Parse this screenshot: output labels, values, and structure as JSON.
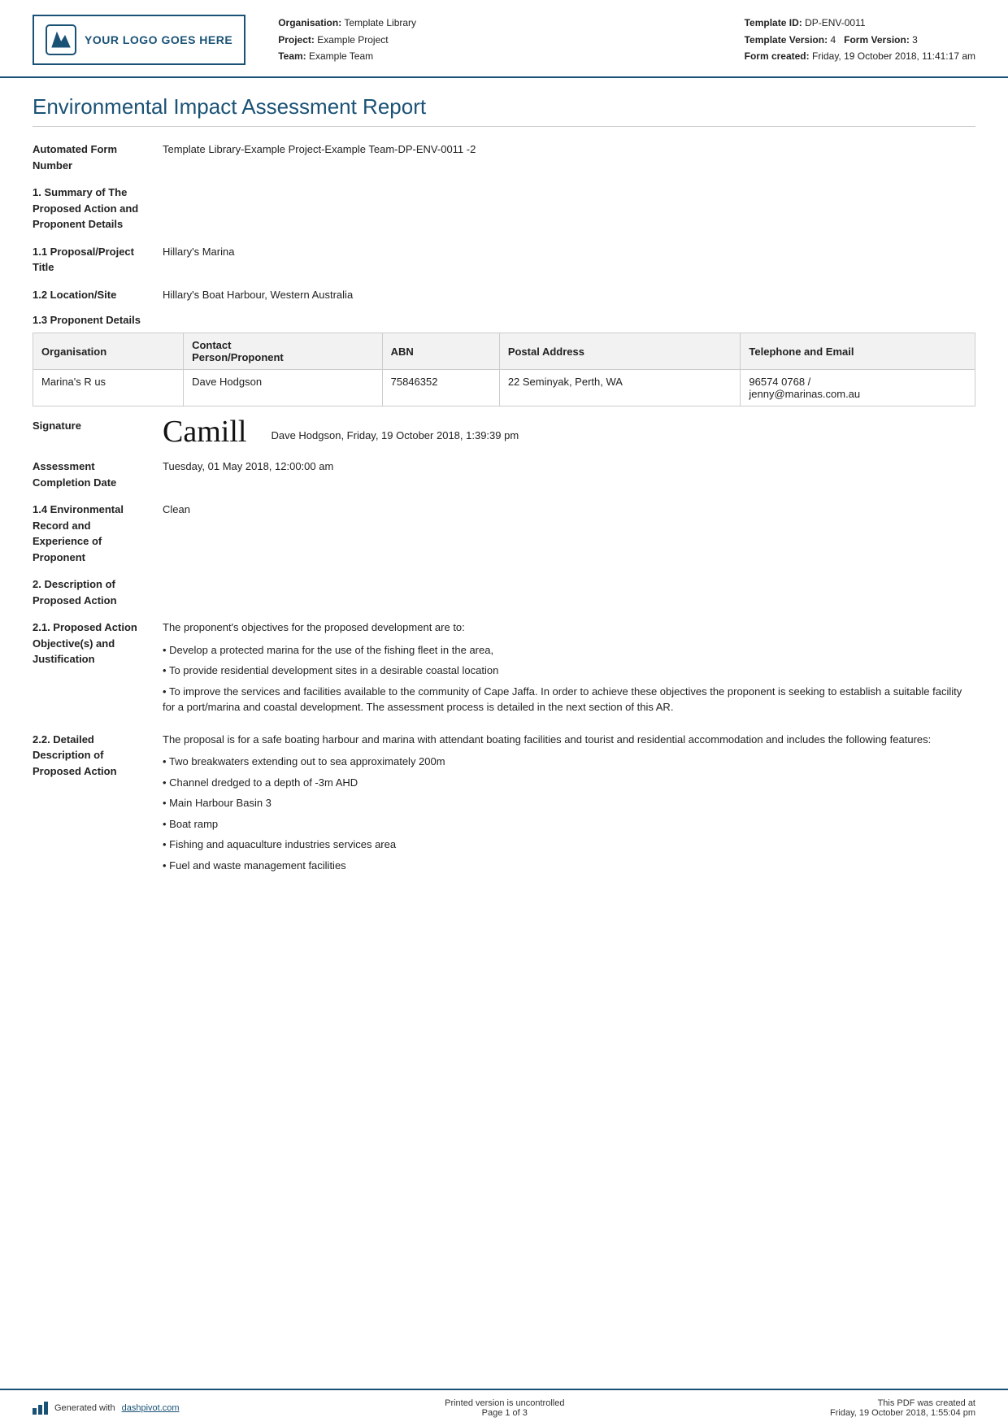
{
  "header": {
    "logo_text": "YOUR LOGO GOES HERE",
    "org_label": "Organisation:",
    "org_value": "Template Library",
    "project_label": "Project:",
    "project_value": "Example Project",
    "team_label": "Team:",
    "team_value": "Example Team",
    "template_id_label": "Template ID:",
    "template_id_value": "DP-ENV-0011",
    "template_version_label": "Template Version:",
    "template_version_value": "4",
    "form_version_label": "Form Version:",
    "form_version_value": "3",
    "form_created_label": "Form created:",
    "form_created_value": "Friday, 19 October 2018, 11:41:17 am"
  },
  "report": {
    "title": "Environmental Impact Assessment Report",
    "automated_form_number_label": "Automated Form Number",
    "automated_form_number_value": "Template Library-Example Project-Example Team-DP-ENV-0011  -2",
    "section1_label": "1. Summary of The Proposed Action and Proponent Details",
    "section1_1_label": "1.1 Proposal/Project Title",
    "section1_1_value": "Hillary's Marina",
    "section1_2_label": "1.2 Location/Site",
    "section1_2_value": "Hillary's Boat Harbour, Western Australia",
    "section1_3_label": "1.3 Proponent Details",
    "table": {
      "headers": [
        "Organisation",
        "Contact Person/Proponent",
        "ABN",
        "Postal Address",
        "Telephone and Email"
      ],
      "rows": [
        [
          "Marina's R us",
          "Dave Hodgson",
          "75846352",
          "22 Seminyak, Perth, WA",
          "96574 0768 /\njenny@marinas.com.au"
        ]
      ]
    },
    "signature_label": "Signature",
    "signature_name": "Dave Hodgson, Friday, 19 October 2018, 1:39:39 pm",
    "signature_cursive": "Camill",
    "assessment_completion_date_label": "Assessment Completion Date",
    "assessment_completion_date_value": "Tuesday, 01 May 2018, 12:00:00 am",
    "section1_4_label": "1.4 Environmental Record and Experience of Proponent",
    "section1_4_value": "Clean",
    "section2_label": "2. Description of Proposed Action",
    "section2_1_label": "2.1. Proposed Action Objective(s) and Justification",
    "section2_1_intro": "The proponent's objectives for the proposed development are to:",
    "section2_1_bullets": [
      "Develop a protected marina for the use of the fishing fleet in the area,",
      "To provide residential development sites in a desirable coastal location",
      "To improve the services and facilities available to the community of Cape Jaffa. In order to achieve these objectives the proponent is seeking to establish a suitable facility for a port/marina and coastal development. The assessment process is detailed in the next section of this AR."
    ],
    "section2_2_label": "2.2. Detailed Description of Proposed Action",
    "section2_2_intro": "The proposal is for a safe boating harbour and marina with attendant boating facilities and tourist and residential accommodation and includes the following features:",
    "section2_2_bullets": [
      "Two breakwaters extending out to sea approximately 200m",
      "Channel dredged to a depth of -3m AHD",
      "Main Harbour Basin 3",
      "Boat ramp",
      "Fishing and aquaculture industries services area",
      "Fuel and waste management facilities"
    ]
  },
  "footer": {
    "generated_text": "Generated with ",
    "dashpivot_link": "dashpivot.com",
    "uncontrolled_text": "Printed version is uncontrolled",
    "page_text": "Page 1 of 3",
    "pdf_created_text": "This PDF was created at",
    "pdf_created_date": "Friday, 19 October 2018, 1:55:04 pm"
  }
}
